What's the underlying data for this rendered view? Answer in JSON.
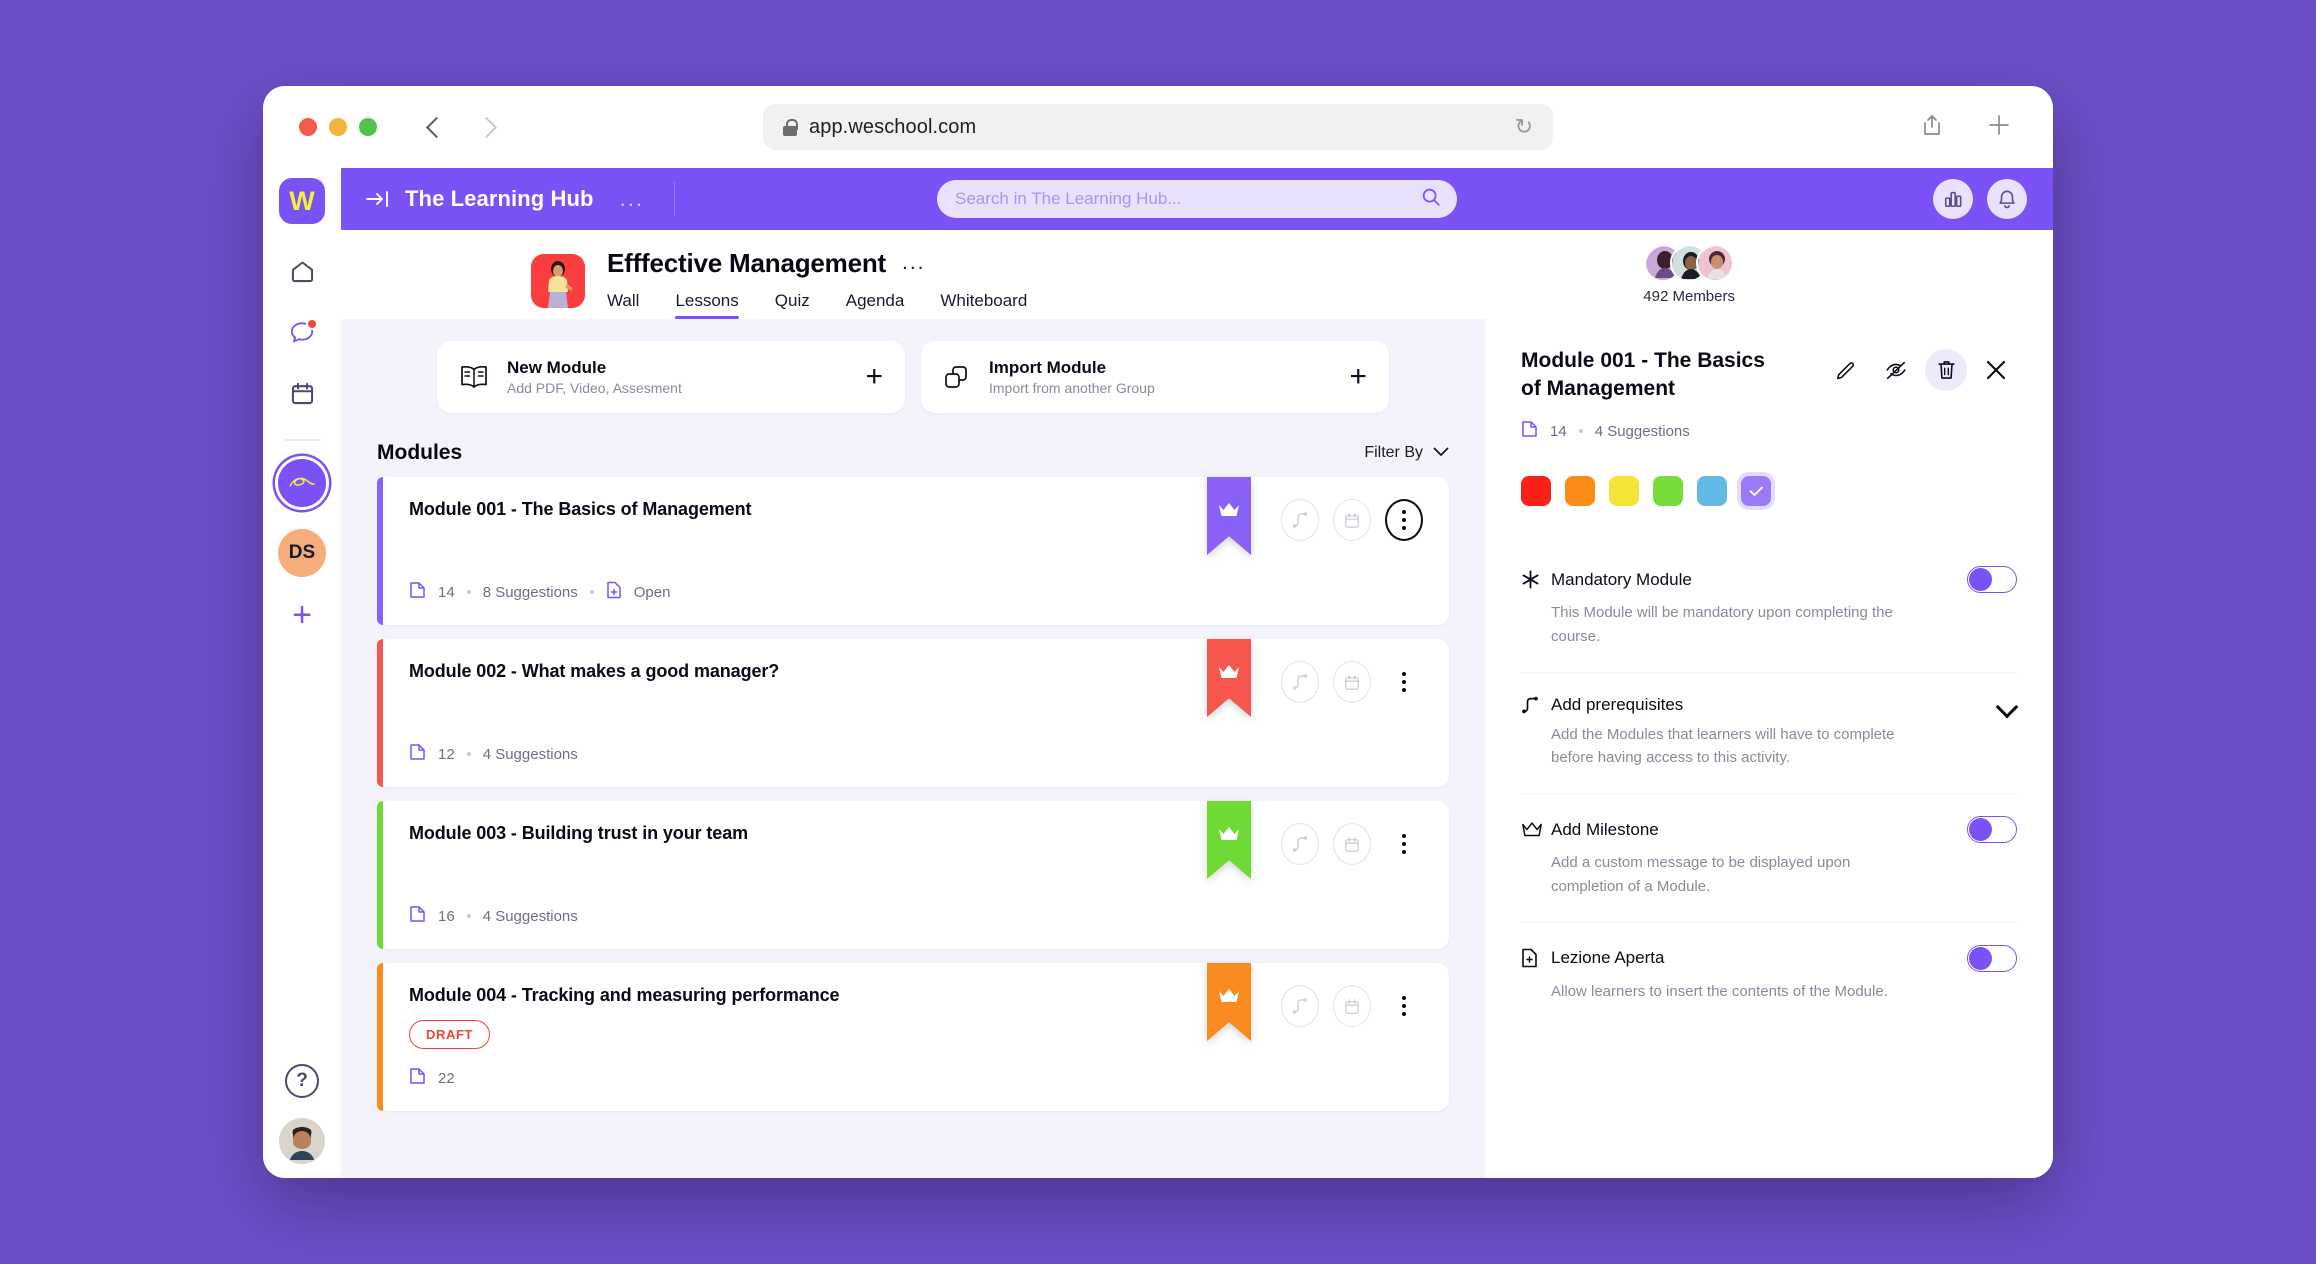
{
  "browser": {
    "url": "app.weschool.com",
    "back_label": "Back",
    "forward_label": "Forward",
    "reload_label": "Reload",
    "share_label": "Share",
    "new_tab_label": "New Tab"
  },
  "rail": {
    "logo_letter": "W",
    "items": [
      {
        "name": "home",
        "label": "Home"
      },
      {
        "name": "chat",
        "label": "Chat",
        "has_badge": true
      },
      {
        "name": "calendar",
        "label": "Calendar"
      }
    ],
    "group_label": "The Learning Hub",
    "ds_initials": "DS",
    "add_label": "+",
    "help_label": "?"
  },
  "topbar": {
    "collapse_label": "Collapse sidebar",
    "title": "The Learning Hub",
    "more_label": "...",
    "search_placeholder": "Search in The Learning Hub...",
    "analytics_label": "Analytics",
    "notifications_label": "Notifications"
  },
  "course": {
    "title": "Efffective Management",
    "more_label": "...",
    "tabs": [
      {
        "label": "Wall",
        "active": false
      },
      {
        "label": "Lessons",
        "active": true
      },
      {
        "label": "Quiz",
        "active": false
      },
      {
        "label": "Agenda",
        "active": false
      },
      {
        "label": "Whiteboard",
        "active": false
      }
    ],
    "members_count": "492 Members"
  },
  "actions": [
    {
      "icon": "book-icon",
      "title": "New Module",
      "subtitle": "Add PDF, Video, Assesment",
      "plus": "+"
    },
    {
      "icon": "copy-icon",
      "title": "Import Module",
      "subtitle": "Import from another Group",
      "plus": "+"
    }
  ],
  "modules_section": {
    "heading": "Modules",
    "filter_label": "Filter By"
  },
  "modules": [
    {
      "title": "Module 001 - The Basics of Management",
      "color": "#8B62F7",
      "pages": "14",
      "suggestions": "8 Suggestions",
      "status": "Open",
      "draft": "",
      "selected": true
    },
    {
      "title": "Module 002 - What makes a good manager?",
      "color": "#F5564E",
      "pages": "12",
      "suggestions": "4 Suggestions",
      "status": "",
      "draft": "",
      "selected": false
    },
    {
      "title": "Module 003 - Building trust in your team",
      "color": "#6FD935",
      "pages": "16",
      "suggestions": "4 Suggestions",
      "status": "",
      "draft": "",
      "selected": false
    },
    {
      "title": "Module 004 - Tracking and measuring performance",
      "color": "#F98A1F",
      "pages": "22",
      "suggestions": "",
      "status": "",
      "draft": "DRAFT",
      "selected": false
    }
  ],
  "panel": {
    "title": "Module 001 - The Basics of Management",
    "pages": "14",
    "suggestions": "4 Suggestions",
    "edit_label": "Edit",
    "hide_label": "Hide",
    "delete_label": "Delete",
    "close_label": "Close",
    "colors": [
      "#FA2118",
      "#FC8A16",
      "#F5E538",
      "#77DD3A",
      "#63B9E5",
      "#9A7AF6"
    ],
    "selected_color": "#9A7AF6",
    "settings": [
      {
        "icon": "asterisk-icon",
        "title": "Mandatory Module",
        "desc": "This Module will be mandatory upon completing the course.",
        "control": "toggle"
      },
      {
        "icon": "path-icon",
        "title": "Add prerequisites",
        "desc": "Add the Modules that learners will have to complete before having access to this activity.",
        "control": "chevron"
      },
      {
        "icon": "crown-icon",
        "title": "Add Milestone",
        "desc": "Add a custom message to be displayed upon completion of a Module.",
        "control": "toggle"
      },
      {
        "icon": "file-plus-icon",
        "title": "Lezione Aperta",
        "desc": "Allow learners to insert the contents of the Module.",
        "control": "toggle"
      }
    ]
  },
  "theme": {
    "brand": "#7B52F5",
    "page_bg": "#6B4FC9",
    "canvas": "#F4F3FC"
  }
}
